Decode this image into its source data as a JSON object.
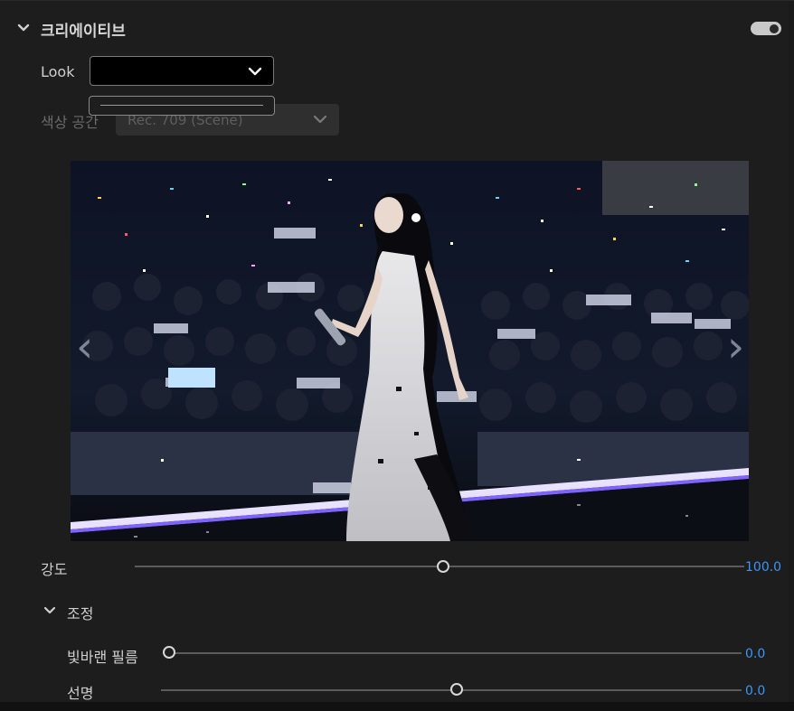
{
  "section": {
    "title": "크리에이티브",
    "enabled": true
  },
  "look": {
    "label": "Look",
    "value": ""
  },
  "color_space": {
    "label": "색상 공간",
    "value": "Rec. 709 (Scene)"
  },
  "preview": {
    "nav_prev": "‹",
    "nav_next": "›"
  },
  "intensity": {
    "label": "강도",
    "value": "100.0",
    "level": 0.5
  },
  "adjust": {
    "title": "조정"
  },
  "faded_film": {
    "label": "빛바랜 필름",
    "value": "0.0",
    "level": 0.0
  },
  "sharpen": {
    "label": "선명",
    "value": "0.0",
    "level": 0.5
  },
  "colors": {
    "accent": "#3d95f4",
    "panel_bg": "#1d1d1d"
  }
}
